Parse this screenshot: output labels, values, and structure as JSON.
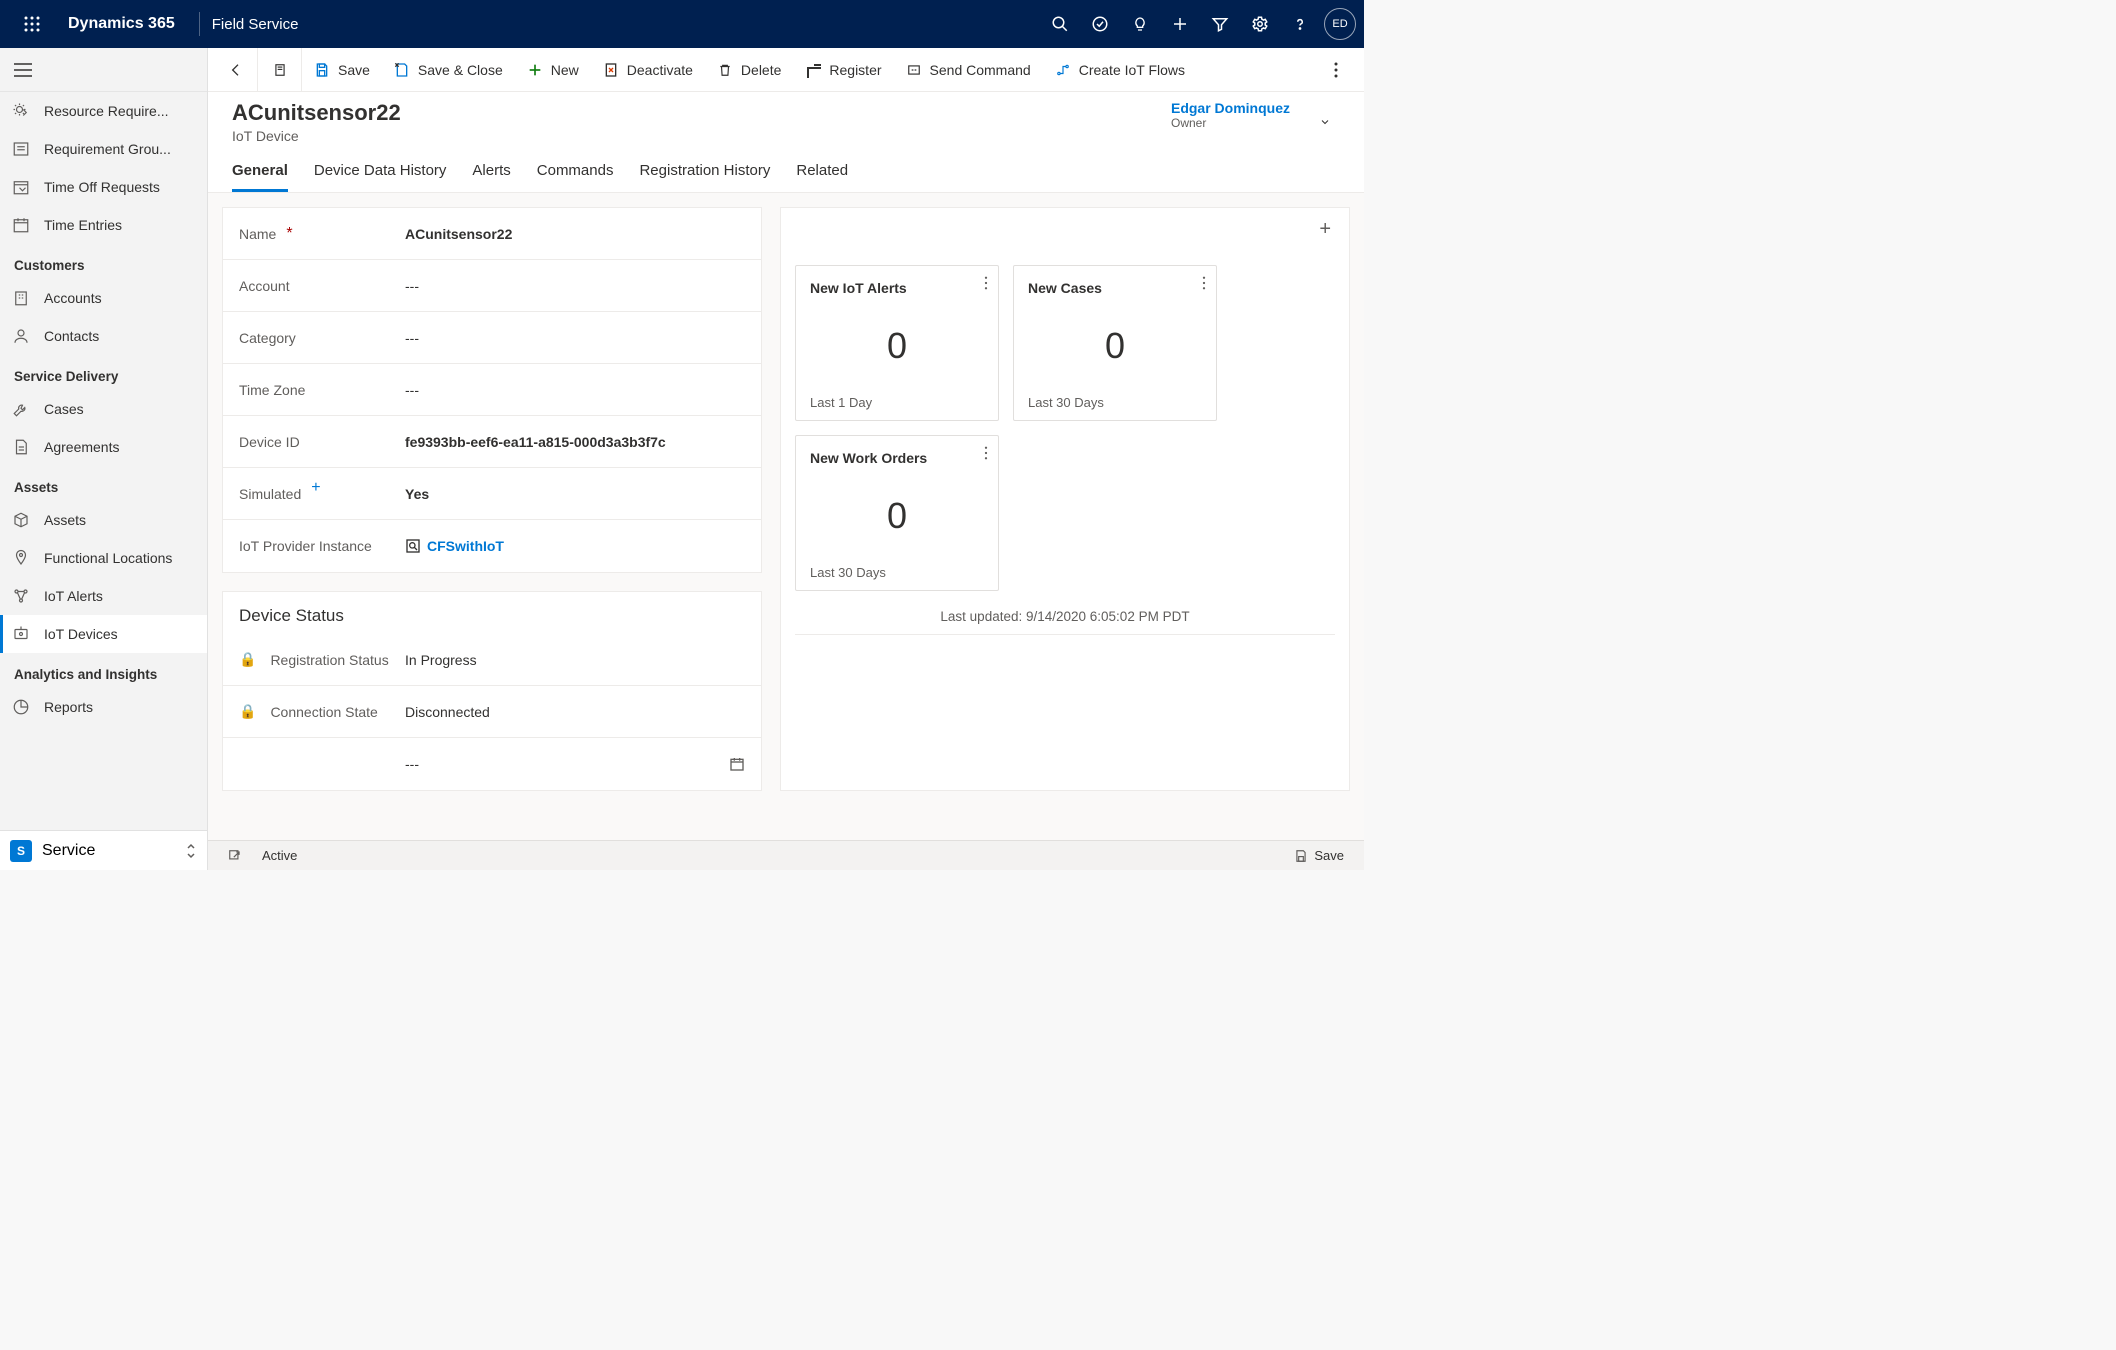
{
  "topbar": {
    "brand": "Dynamics 365",
    "appname": "Field Service",
    "avatar": "ED"
  },
  "leftnav": {
    "groups": [
      {
        "label": null,
        "items": [
          {
            "label": "Resource Require...",
            "icon": "gear-arrow"
          },
          {
            "label": "Requirement Grou...",
            "icon": "list-box"
          },
          {
            "label": "Time Off Requests",
            "icon": "calendar-check"
          },
          {
            "label": "Time Entries",
            "icon": "calendar"
          }
        ]
      },
      {
        "label": "Customers",
        "items": [
          {
            "label": "Accounts",
            "icon": "building"
          },
          {
            "label": "Contacts",
            "icon": "person"
          }
        ]
      },
      {
        "label": "Service Delivery",
        "items": [
          {
            "label": "Cases",
            "icon": "wrench"
          },
          {
            "label": "Agreements",
            "icon": "doc"
          }
        ]
      },
      {
        "label": "Assets",
        "items": [
          {
            "label": "Assets",
            "icon": "cube"
          },
          {
            "label": "Functional Locations",
            "icon": "pin"
          },
          {
            "label": "IoT Alerts",
            "icon": "node"
          },
          {
            "label": "IoT Devices",
            "icon": "device",
            "active": true
          }
        ]
      },
      {
        "label": "Analytics and Insights",
        "items": [
          {
            "label": "Reports",
            "icon": "chart"
          }
        ]
      }
    ],
    "area": {
      "letter": "S",
      "label": "Service"
    }
  },
  "cmdbar": {
    "save": "Save",
    "saveclose": "Save & Close",
    "new": "New",
    "deactivate": "Deactivate",
    "delete": "Delete",
    "register": "Register",
    "sendcmd": "Send Command",
    "createflow": "Create IoT Flows"
  },
  "header": {
    "title": "ACunitsensor22",
    "subtitle": "IoT Device",
    "owner_name": "Edgar Dominquez",
    "owner_label": "Owner"
  },
  "tabs": [
    "General",
    "Device Data History",
    "Alerts",
    "Commands",
    "Registration History",
    "Related"
  ],
  "form": {
    "name": {
      "label": "Name",
      "value": "ACunitsensor22",
      "required": true
    },
    "account": {
      "label": "Account",
      "value": "---"
    },
    "category": {
      "label": "Category",
      "value": "---"
    },
    "timezone": {
      "label": "Time Zone",
      "value": "---"
    },
    "deviceid": {
      "label": "Device ID",
      "value": "fe9393bb-eef6-ea11-a815-000d3a3b3f7c"
    },
    "simulated": {
      "label": "Simulated",
      "value": "Yes",
      "recommended": true
    },
    "provider": {
      "label": "IoT Provider Instance",
      "value": "CFSwithIoT"
    }
  },
  "device_status": {
    "heading": "Device Status",
    "reg_label": "Registration Status",
    "reg_value": "In Progress",
    "conn_label": "Connection State",
    "conn_value": "Disconnected",
    "extra_value": "---"
  },
  "tiles": [
    {
      "title": "New IoT Alerts",
      "value": "0",
      "footer": "Last 1 Day"
    },
    {
      "title": "New Cases",
      "value": "0",
      "footer": "Last 30 Days"
    },
    {
      "title": "New Work Orders",
      "value": "0",
      "footer": "Last 30 Days"
    }
  ],
  "lastupdated": "Last updated: 9/14/2020 6:05:02 PM PDT",
  "statusbar": {
    "status": "Active",
    "save": "Save"
  }
}
